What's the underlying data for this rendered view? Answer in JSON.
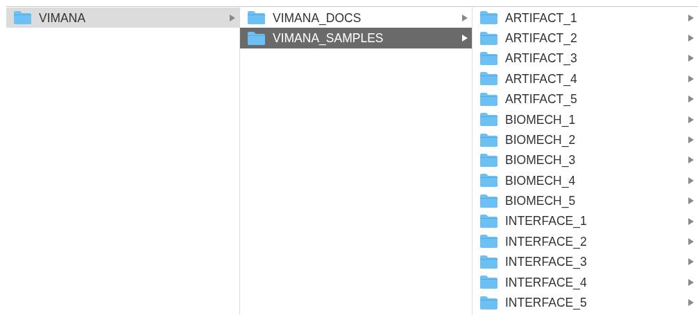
{
  "columns": [
    {
      "active": false,
      "items": [
        {
          "label": "VIMANA",
          "selected": true,
          "has_children": true
        }
      ]
    },
    {
      "active": true,
      "items": [
        {
          "label": "VIMANA_DOCS",
          "selected": false,
          "has_children": true
        },
        {
          "label": "VIMANA_SAMPLES",
          "selected": true,
          "has_children": true
        }
      ]
    },
    {
      "items": [
        {
          "label": "ARTIFACT_1",
          "selected": false,
          "has_children": true
        },
        {
          "label": "ARTIFACT_2",
          "selected": false,
          "has_children": true
        },
        {
          "label": "ARTIFACT_3",
          "selected": false,
          "has_children": true
        },
        {
          "label": "ARTIFACT_4",
          "selected": false,
          "has_children": true
        },
        {
          "label": "ARTIFACT_5",
          "selected": false,
          "has_children": true
        },
        {
          "label": "BIOMECH_1",
          "selected": false,
          "has_children": true
        },
        {
          "label": "BIOMECH_2",
          "selected": false,
          "has_children": true
        },
        {
          "label": "BIOMECH_3",
          "selected": false,
          "has_children": true
        },
        {
          "label": "BIOMECH_4",
          "selected": false,
          "has_children": true
        },
        {
          "label": "BIOMECH_5",
          "selected": false,
          "has_children": true
        },
        {
          "label": "INTERFACE_1",
          "selected": false,
          "has_children": true
        },
        {
          "label": "INTERFACE_2",
          "selected": false,
          "has_children": true
        },
        {
          "label": "INTERFACE_3",
          "selected": false,
          "has_children": true
        },
        {
          "label": "INTERFACE_4",
          "selected": false,
          "has_children": true
        },
        {
          "label": "INTERFACE_5",
          "selected": false,
          "has_children": true
        }
      ]
    }
  ]
}
